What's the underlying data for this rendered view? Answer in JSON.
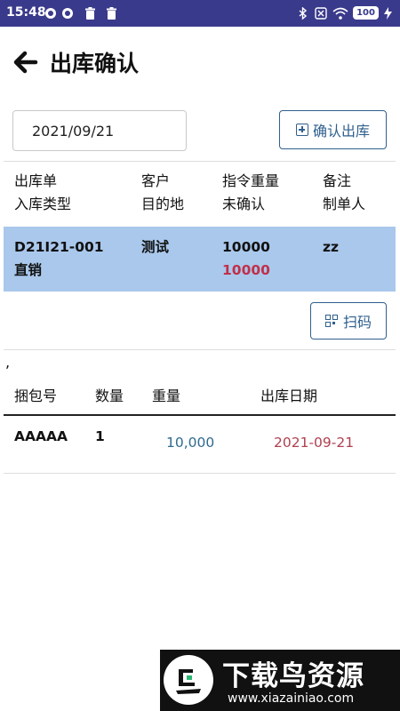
{
  "status_bar": {
    "time": "15:48",
    "battery": "100",
    "icons_left": [
      "record-icon",
      "record-icon",
      "trash-icon",
      "trash-icon"
    ],
    "icons_right": [
      "bluetooth-icon",
      "no-sim-icon",
      "wifi-icon",
      "battery-icon",
      "charging-icon"
    ]
  },
  "header": {
    "title": "出库确认",
    "back_icon": "arrow-left-icon"
  },
  "form": {
    "date_value": "2021/09/21",
    "confirm_label": "确认出库",
    "confirm_icon": "plus-square-icon"
  },
  "orders_table": {
    "headers": [
      {
        "line1": "出库单",
        "line2": "入库类型"
      },
      {
        "line1": "客户",
        "line2": "目的地"
      },
      {
        "line1": "指令重量",
        "line2": "未确认"
      },
      {
        "line1": "备注",
        "line2": "制单人"
      }
    ],
    "rows": [
      {
        "order_no": "D21I21-001",
        "type": "直销",
        "customer": "测试",
        "destination": "",
        "weight": "10000",
        "unconfirmed": "10000",
        "remark": "zz",
        "creator": ""
      }
    ]
  },
  "scan": {
    "label": "扫码",
    "icon": "qr-code-icon"
  },
  "separator_text": ",",
  "bundles_table": {
    "headers": [
      "捆包号",
      "数量",
      "重量",
      "出库日期"
    ],
    "rows": [
      {
        "bundle_no": "AAAAA",
        "quantity": "1",
        "weight": "10,000",
        "date": "2021-09-21"
      }
    ]
  },
  "colors": {
    "status_bar": "#3a3a8c",
    "accent": "#2f5f8d",
    "selected_row": "#a9c8ec",
    "unconfirmed": "#c0304a",
    "weight": "#2f6a90",
    "date": "#b04050"
  },
  "watermark": {
    "title": "下载鸟资源",
    "url": "www.xiazainiao.com"
  }
}
